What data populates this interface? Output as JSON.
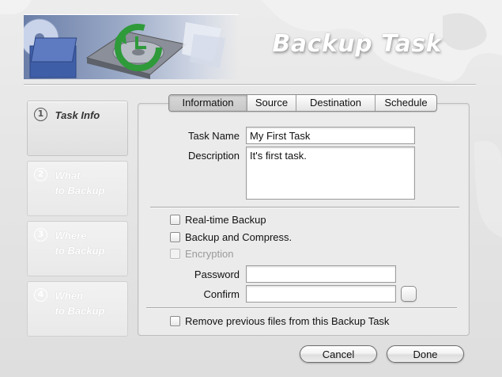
{
  "header": {
    "title": "Backup Task"
  },
  "steps": [
    {
      "number": "1",
      "label": "Task Info",
      "active": true
    },
    {
      "number": "2",
      "label_line1": "What",
      "label_line2": "to Backup",
      "active": false
    },
    {
      "number": "3",
      "label_line1": "Where",
      "label_line2": "to Backup",
      "active": false
    },
    {
      "number": "4",
      "label_line1": "When",
      "label_line2": "to Backup",
      "active": false
    }
  ],
  "tabs": [
    {
      "label": "Information",
      "selected": true
    },
    {
      "label": "Source",
      "selected": false
    },
    {
      "label": "Destination",
      "selected": false
    },
    {
      "label": "Schedule",
      "selected": false
    }
  ],
  "form": {
    "task_name_label": "Task Name",
    "task_name_value": "My First Task",
    "description_label": "Description",
    "description_value": "It's first task.",
    "realtime_label": "Real-time Backup",
    "realtime_checked": false,
    "compress_label": "Backup and Compress.",
    "compress_checked": false,
    "encryption_label": "Encryption",
    "encryption_checked": false,
    "encryption_enabled": false,
    "password_label": "Password",
    "password_value": "",
    "confirm_label": "Confirm",
    "confirm_value": "",
    "remove_prev_label": "Remove previous files from this Backup Task",
    "remove_prev_checked": false
  },
  "buttons": {
    "cancel": "Cancel",
    "done": "Done"
  },
  "icons": {
    "banner": "backup-drive-icon"
  },
  "colors": {
    "title_text": "#ffffff",
    "accent_green": "#2e9a3a",
    "banner_blue": "#6a7ea8"
  }
}
